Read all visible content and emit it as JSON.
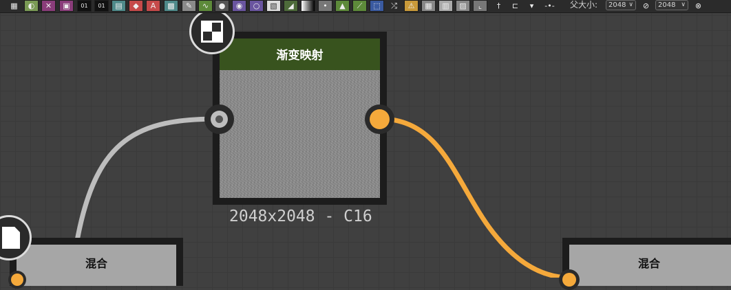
{
  "toolbar": {
    "size_label": "父大小:",
    "size_value": "2048",
    "second_size_value": "2048"
  },
  "nodes": {
    "gradient_map": {
      "title": "渐变映射",
      "resolution": "2048x2048 - C16"
    },
    "blend_left": {
      "title": "混合"
    },
    "blend_right": {
      "title": "混合"
    }
  },
  "colors": {
    "input_wire": "#bdbdbd",
    "output_wire": "#f5a93b",
    "header_green": "#38531e",
    "blend_header": "#a6a6a6"
  }
}
